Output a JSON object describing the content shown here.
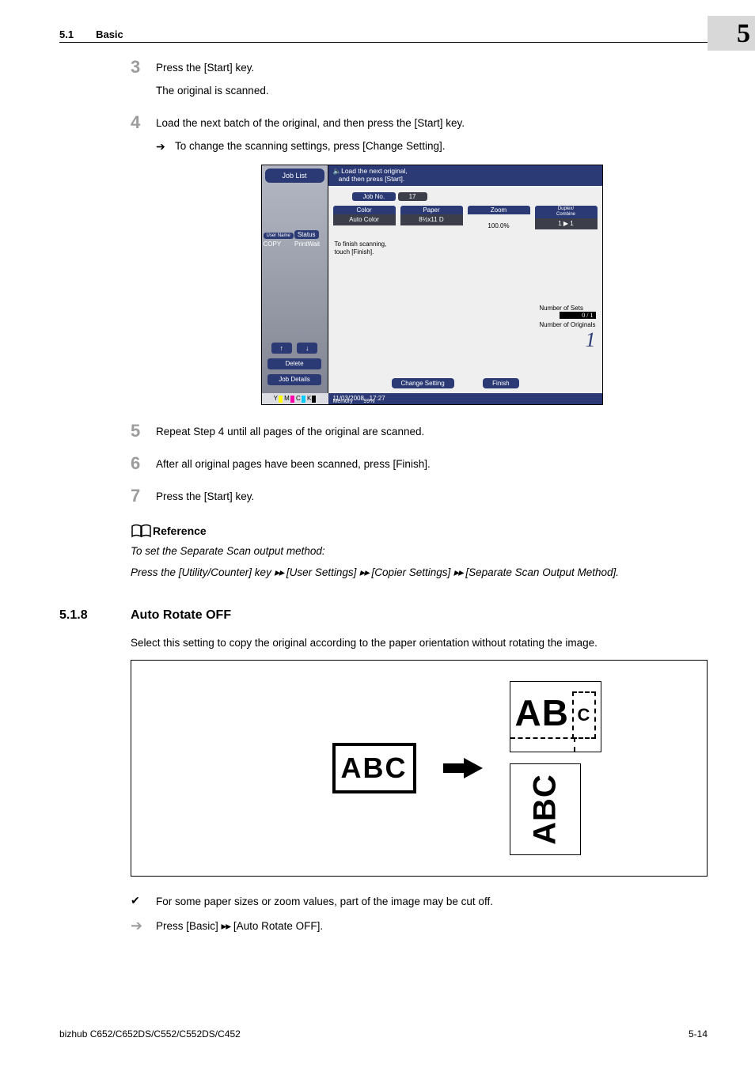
{
  "header": {
    "section_num": "5.1",
    "section_name": "Basic"
  },
  "chapter_badge": "5",
  "steps": {
    "s3": {
      "num": "3",
      "line1": "Press the [Start] key.",
      "line2": "The original is scanned."
    },
    "s4": {
      "num": "4",
      "line1": "Load the next batch of the original, and then press the [Start] key.",
      "sub1": "To change the scanning settings, press [Change Setting]."
    },
    "s5": {
      "num": "5",
      "line1": "Repeat Step 4 until all pages of the original are scanned."
    },
    "s6": {
      "num": "6",
      "line1": "After all original pages have been scanned, press [Finish]."
    },
    "s7": {
      "num": "7",
      "line1": "Press the [Start] key."
    }
  },
  "screenshot": {
    "job_list": "Job List",
    "top_msg_l1": "Load the next original,",
    "top_msg_l2": "and then press [Start].",
    "job_no_label": "Job No.",
    "job_no_value": "17",
    "cols": {
      "c1h": "Color",
      "c1v": "Auto Color",
      "c2h": "Paper",
      "c2v": "8½x11 D",
      "c3h": "Zoom",
      "c3v": "100.0%",
      "c4h": "Duplex/\nCombine",
      "c4v": "1 ▶ 1"
    },
    "left_tabs": {
      "user": "User\nName",
      "status": "Status",
      "copy": "COPY",
      "printwait": "PrintWait"
    },
    "finish_msg_l1": "To finish scanning,",
    "finish_msg_l2": "touch [Finish].",
    "sets_label": "Number of Sets",
    "sets_value": "0 / 1",
    "originals_label": "Number of Originals",
    "originals_value": "1",
    "delete": "Delete",
    "job_details": "Job Details",
    "change_setting": "Change Setting",
    "finish": "Finish",
    "status_date": "11/03/2008",
    "status_time": "17:27",
    "status_mem_label": "Memory",
    "status_mem_value": "99%",
    "ymck": "Y▮ M▮ C▮ K▮"
  },
  "reference": {
    "title": "Reference",
    "line1": "To set the Separate Scan output method:",
    "line2_a": "Press the [Utility/Counter] key ",
    "line2_b": " [User Settings] ",
    "line2_c": " [Copier Settings] ",
    "line2_d": " [Separate Scan Output Method].",
    "arrows": "▸▸"
  },
  "section518": {
    "num": "5.1.8",
    "title": "Auto Rotate OFF",
    "intro": "Select this setting to copy the original according to the paper orientation without rotating the image.",
    "abc": "ABC",
    "ab": "AB",
    "c": "C",
    "abc_rot": "ABC"
  },
  "notes": {
    "check": "For some paper sizes or zoom values, part of the image may be cut off.",
    "proc_a": "Press [Basic] ",
    "proc_b": " [Auto Rotate OFF].",
    "arrows": "▸▸"
  },
  "footer": {
    "model": "bizhub C652/C652DS/C552/C552DS/C452",
    "pageno": "5-14"
  }
}
